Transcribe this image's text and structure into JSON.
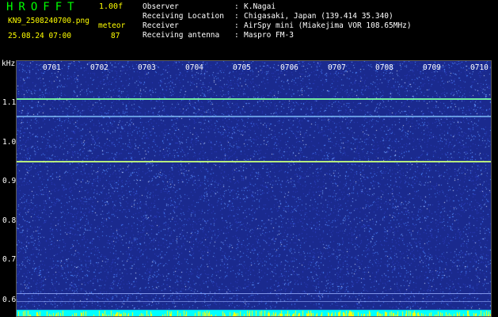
{
  "header": {
    "app_title": "HROFFT",
    "version": "1.00f",
    "filename": "KN9_2508240700.png",
    "mode": "meteor",
    "datetime": "25.08.24 07:00",
    "count": "87",
    "info": [
      {
        "key": "Observer",
        "value": "K.Nagai"
      },
      {
        "key": "Receiving Location",
        "value": "Chigasaki, Japan (139.414 35.340)"
      },
      {
        "key": "Receiver",
        "value": "AirSpy mini (Miakejima VOR 108.65MHz)"
      },
      {
        "key": "Receiving antenna",
        "value": "Maspro FM-3"
      }
    ]
  },
  "spectrogram": {
    "y_unit": "kHz",
    "y_ticks": [
      "1.1",
      "1.0",
      "0.9",
      "0.8",
      "0.7",
      "0.6"
    ],
    "time_ticks": [
      "0701",
      "0702",
      "0703",
      "0704",
      "0705",
      "0706",
      "0707",
      "0708",
      "0709",
      "0710"
    ],
    "background_color": "#1a2a8e",
    "signal_colors": {
      "carrier": "#9cff9c",
      "noise": "#4a88ff",
      "strip_cyan": "#00ffff",
      "strip_yellow": "#ffff00"
    }
  }
}
